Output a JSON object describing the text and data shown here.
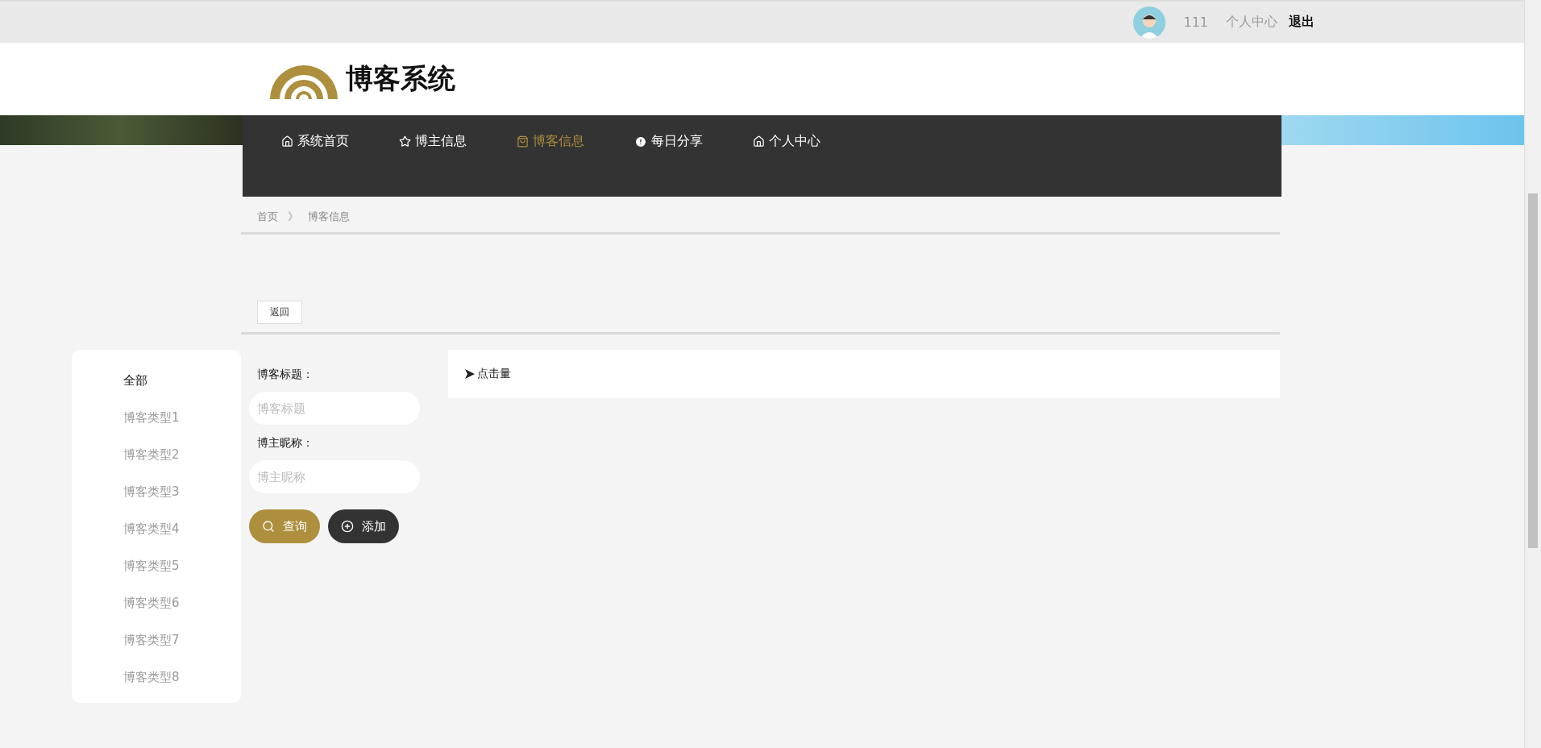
{
  "top_bar": {
    "username": "111",
    "links": [
      {
        "label": "个人中心",
        "kind": "link"
      },
      {
        "label": "退出",
        "kind": "logout"
      }
    ]
  },
  "header": {
    "title": "博客系统"
  },
  "nav": [
    {
      "label": "系统首页",
      "kind": "home",
      "selected": false
    },
    {
      "label": "博主信息",
      "kind": "star",
      "selected": false
    },
    {
      "label": "博客信息",
      "kind": "bag",
      "selected": true
    },
    {
      "label": "每日分享",
      "kind": "alert",
      "selected": false
    },
    {
      "label": "个人中心",
      "kind": "home",
      "selected": false
    }
  ],
  "breadcrumb": [
    "首页",
    "博客信息"
  ],
  "breadcrumb_separator": "》",
  "back_button": "返回",
  "sidebar": {
    "items": [
      {
        "label": "全部",
        "selected": true
      },
      {
        "label": "博客类型1",
        "selected": false
      },
      {
        "label": "博客类型2",
        "selected": false
      },
      {
        "label": "博客类型3",
        "selected": false
      },
      {
        "label": "博客类型4",
        "selected": false
      },
      {
        "label": "博客类型5",
        "selected": false
      },
      {
        "label": "博客类型6",
        "selected": false
      },
      {
        "label": "博客类型7",
        "selected": false
      },
      {
        "label": "博客类型8",
        "selected": false
      }
    ]
  },
  "search": {
    "fields": [
      {
        "label": "博客标题：",
        "placeholder": "博客标题"
      },
      {
        "label": "博主昵称：",
        "placeholder": "博主昵称"
      }
    ],
    "buttons": [
      {
        "label": "查询",
        "kind": "search"
      },
      {
        "label": "添加",
        "kind": "add"
      }
    ]
  },
  "sort_bar": {
    "items": [
      {
        "label": "点击量"
      }
    ]
  }
}
